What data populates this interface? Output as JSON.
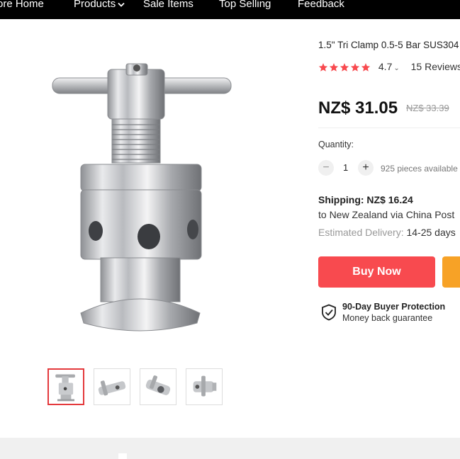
{
  "nav": {
    "items": [
      "ore Home",
      "Products",
      "Sale Items",
      "Top Selling",
      "Feedback"
    ]
  },
  "product": {
    "title": "1.5\" Tri Clamp 0.5-5 Bar SUS304",
    "rating_value": "4.7",
    "rating_stars": 5,
    "reviews": "15 Reviews",
    "price": "NZ$ 31.05",
    "old_price": "NZ$ 33.39"
  },
  "quantity": {
    "label": "Quantity:",
    "minus": "−",
    "plus": "+",
    "value": "1",
    "available": "925 pieces available"
  },
  "shipping": {
    "cost": "Shipping: NZ$ 16.24",
    "route": "to New Zealand via China Post",
    "estimate_label": "Estimated Delivery: ",
    "estimate_days": "14-25 days"
  },
  "actions": {
    "buy_now": "Buy Now"
  },
  "protection": {
    "title": "90-Day Buyer Protection",
    "subtitle": "Money back guarantee"
  },
  "colors": {
    "nav_bg": "#000000",
    "buy_button": "#f84a4f",
    "cart_button": "#f7a226",
    "star": "#f84a4f",
    "thumb_active_border": "#e4393c"
  }
}
